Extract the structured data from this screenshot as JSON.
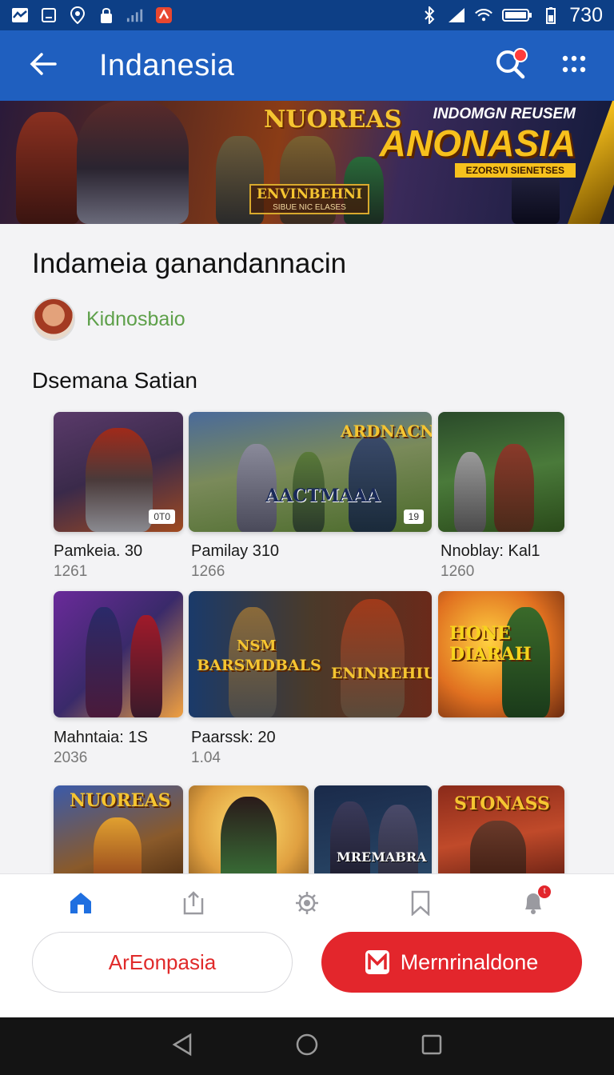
{
  "status_bar": {
    "time": "730"
  },
  "app_bar": {
    "title": "Indanesia"
  },
  "banner": {
    "center_title": "NUOREAS",
    "box_title": "ENVINBEHNI",
    "box_sub": "SIBUE NIC ELASES",
    "right_line1": "INDOMGN REUSEM",
    "right_title": "ANONASIA",
    "right_sub": "EZORSVI SIENETSES"
  },
  "article": {
    "heading": "Indameia ganandannacin",
    "author": "Kidnosbaio",
    "section_title": "Dsemana Satian"
  },
  "tiles": [
    {
      "label": "",
      "chip": "0T0"
    },
    {
      "label": "AACTMAAA",
      "top_label": "ARDNACN",
      "chip": "19"
    },
    {
      "label": "",
      "chip": ""
    },
    {
      "label": "",
      "chip": ""
    },
    {
      "label": "BARSMDBALS",
      "top_label": "NSM",
      "chip": ""
    },
    {
      "label": "ENINREHIU",
      "chip": ""
    },
    {
      "label": "HONE DIARAH",
      "chip": ""
    },
    {
      "label": "NUOREAS",
      "chip": ""
    },
    {
      "label": "",
      "chip": ""
    },
    {
      "label": "MREMABRA",
      "chip": ""
    },
    {
      "label": "STONASS",
      "chip": ""
    }
  ],
  "cards": [
    {
      "title": "Pamkeia. 30",
      "meta": "1261"
    },
    {
      "title": "Pamilay 310",
      "meta": "1266"
    },
    {
      "title": "Nnoblay: Kal1",
      "meta": "1260"
    },
    {
      "title": "Mahntaia: 1S",
      "meta": "2036"
    },
    {
      "title": "Paarssk: 20",
      "meta": "1.04"
    }
  ],
  "bottom_nav": {
    "items": [
      "home-icon",
      "share-icon",
      "settings-icon",
      "bookmark-icon",
      "notifications-icon"
    ],
    "badge": "t"
  },
  "actions": {
    "secondary_label": "ArEonpasia",
    "primary_label": "Mernrinaldone"
  },
  "colors": {
    "app_bar": "#1f5fbf",
    "status_bar": "#0d3f86",
    "primary_button": "#e3262c",
    "author_green": "#5ea04a"
  }
}
